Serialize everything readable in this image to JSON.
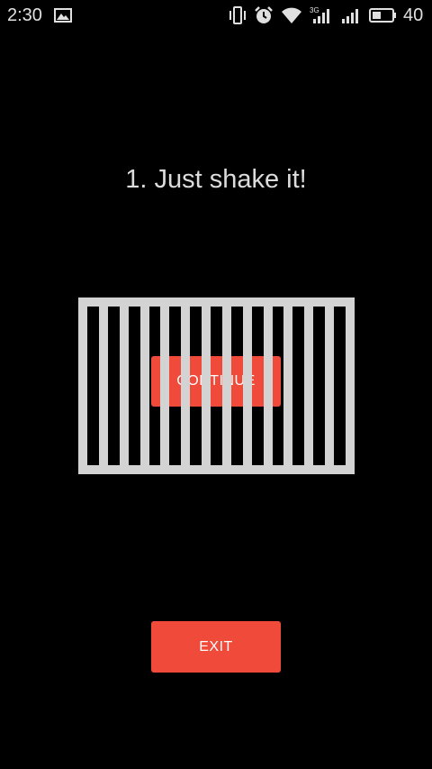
{
  "status_bar": {
    "time": "2:30",
    "battery_level": "40",
    "icons": [
      "image-icon",
      "vibrate-icon",
      "alarm-icon",
      "wifi-icon",
      "signal-3g-icon",
      "signal-icon",
      "battery-icon"
    ]
  },
  "screen": {
    "title": "1. Just shake it!",
    "continue_label": "CONTINUE",
    "exit_label": "EXIT"
  },
  "colors": {
    "background": "#000000",
    "accent": "#f04a3b",
    "cage": "#d3d3d3"
  }
}
